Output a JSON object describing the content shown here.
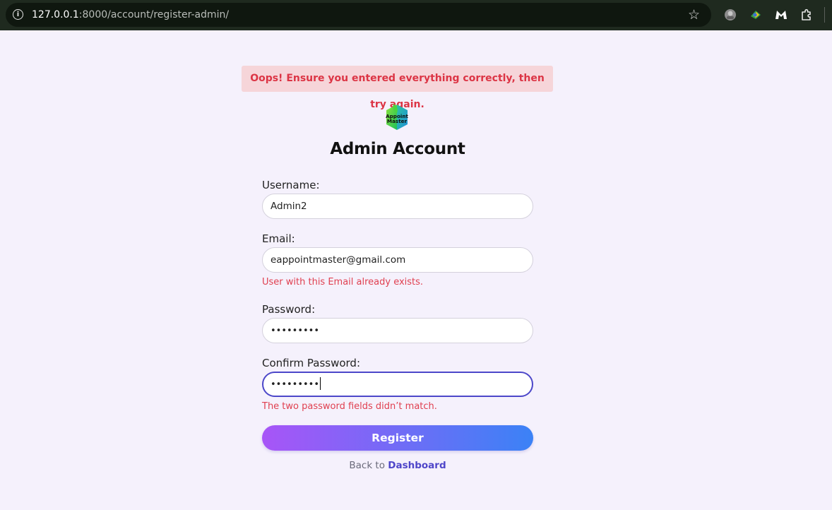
{
  "browser": {
    "url_host": "127.0.0.1",
    "url_path": ":8000/account/register-admin/"
  },
  "alert": {
    "message": "Oops! Ensure you entered everything correctly, then try again."
  },
  "logo": {
    "text_line1": "Appoint",
    "text_line2": "Master"
  },
  "page": {
    "title": "Admin Account"
  },
  "form": {
    "username": {
      "label": "Username:",
      "value": "Admin2"
    },
    "email": {
      "label": "Email:",
      "value": "eappointmaster@gmail.com",
      "error": "User with this Email already exists."
    },
    "password": {
      "label": "Password:",
      "masked": "•••••••••"
    },
    "confirm_password": {
      "label": "Confirm Password:",
      "masked": "•••••••••",
      "error": "The two password fields didn’t match."
    },
    "submit_label": "Register"
  },
  "footer": {
    "back_text": "Back to",
    "dashboard_link": "Dashboard"
  },
  "colors": {
    "page_bg": "#f5f1fc",
    "alert_bg": "#f6d5d9",
    "error": "#dc3545",
    "button_start": "#a855f7",
    "button_end": "#3b82f6",
    "link": "#4f46c9"
  }
}
